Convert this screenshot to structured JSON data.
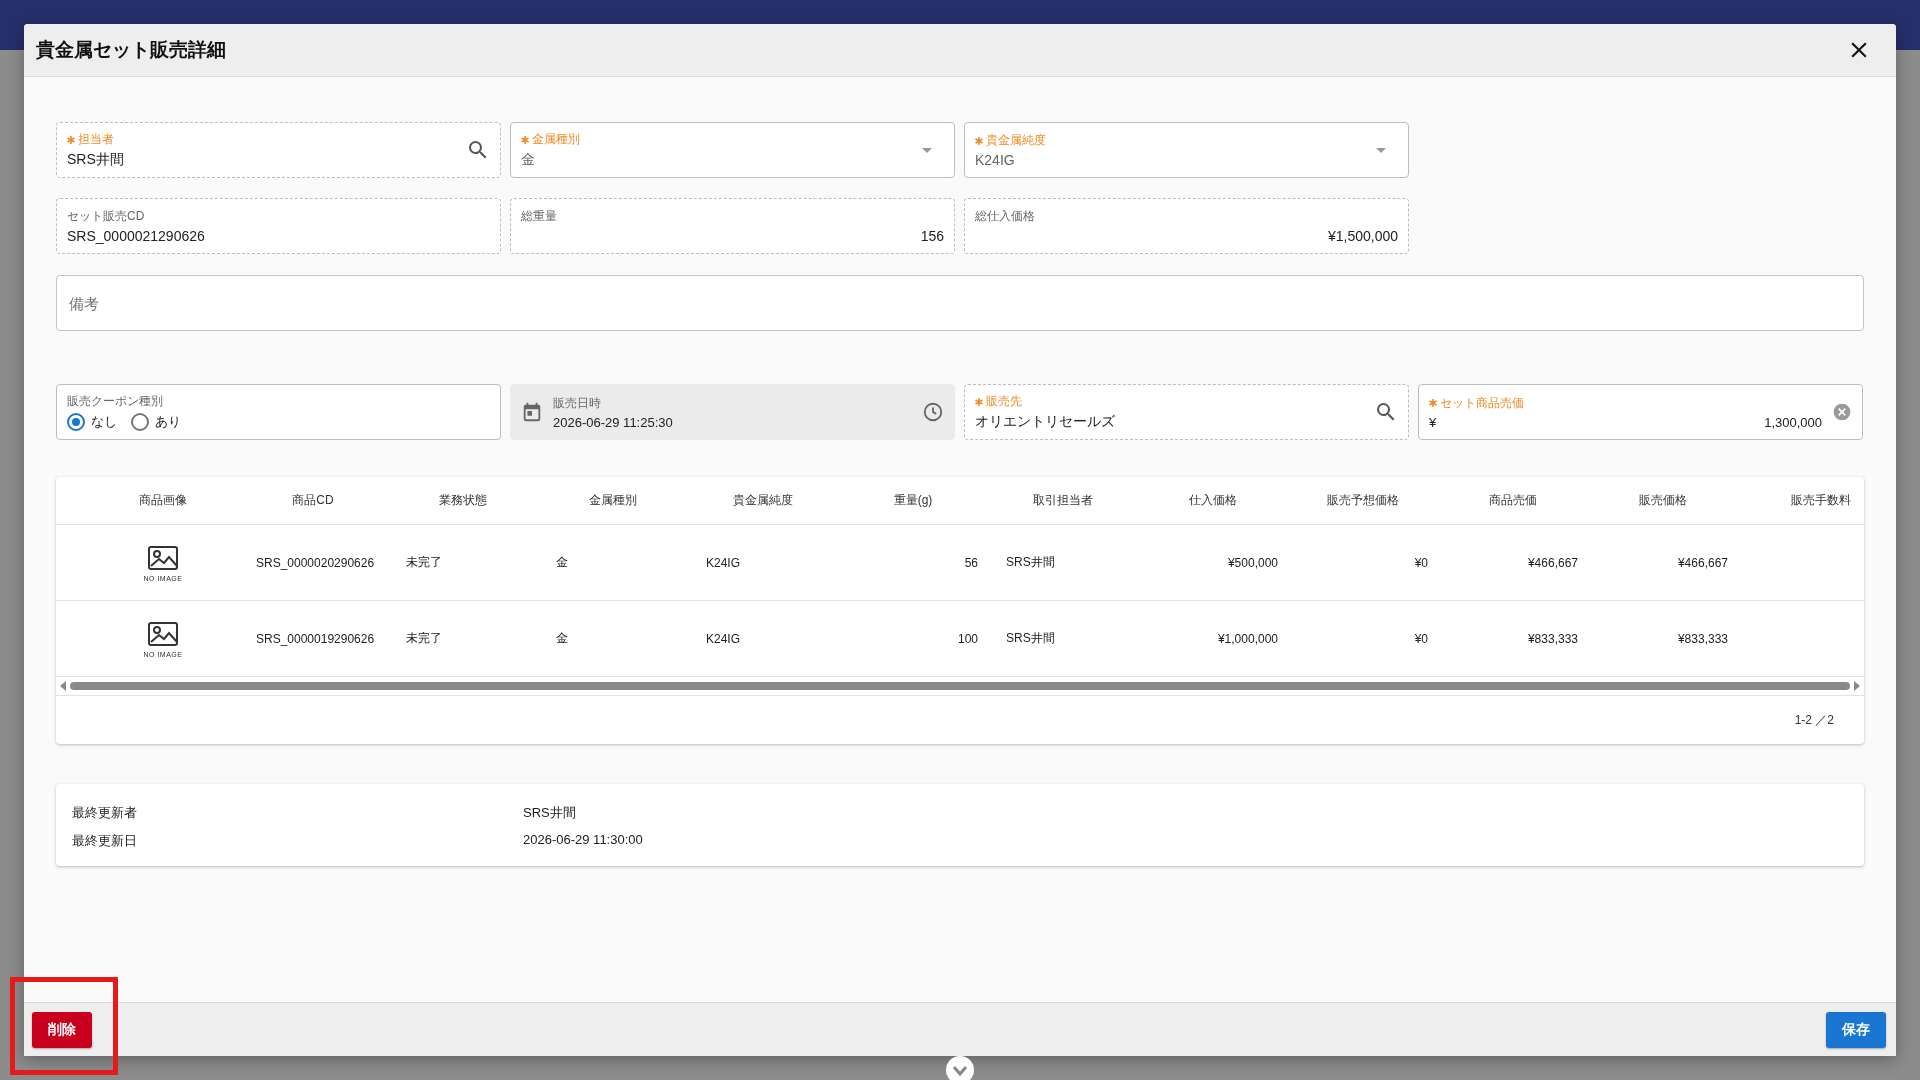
{
  "dialog": {
    "title": "貴金属セット販売詳細"
  },
  "fields": [
    {
      "kind": "search",
      "label": "担当者",
      "required": true,
      "value": "SRS井間"
    },
    {
      "kind": "select",
      "label": "金属種別",
      "required": true,
      "value": "金"
    },
    {
      "kind": "select",
      "label": "貴金属純度",
      "required": true,
      "value": "K24IG"
    },
    {
      "kind": "readonly_text",
      "label": "セット販売CD",
      "required": false,
      "value": "SRS_0000021290626"
    },
    {
      "kind": "readonly_number",
      "label": "総重量",
      "required": false,
      "value": "156"
    },
    {
      "kind": "readonly_number",
      "label": "総仕入価格",
      "required": false,
      "value": "¥1,500,000"
    }
  ],
  "remarks": {
    "placeholder": "備考"
  },
  "sale_fields": [
    {
      "kind": "radio",
      "label": "販売クーポン種別",
      "required": false,
      "options": [
        {
          "label": "なし",
          "selected": true
        },
        {
          "label": "あり",
          "selected": false
        }
      ]
    },
    {
      "kind": "datetime",
      "label": "販売日時",
      "required": false,
      "value": "2026-06-29 11:25:30"
    },
    {
      "kind": "search",
      "label": "販売先",
      "required": true,
      "value": "オリエントリセールズ"
    },
    {
      "kind": "money",
      "label": "セット商品売価",
      "required": true,
      "prefix": "¥",
      "value": "1,300,000"
    }
  ],
  "table": {
    "columns": [
      {
        "label": "商品画像",
        "kind": "image"
      },
      {
        "label": "商品CD",
        "kind": "text"
      },
      {
        "label": "業務状態",
        "kind": "text"
      },
      {
        "label": "金属種別",
        "kind": "text"
      },
      {
        "label": "貴金属純度",
        "kind": "text"
      },
      {
        "label": "重量(g)",
        "kind": "number"
      },
      {
        "label": "取引担当者",
        "kind": "text"
      },
      {
        "label": "仕入価格",
        "kind": "number"
      },
      {
        "label": "販売予想価格",
        "kind": "number"
      },
      {
        "label": "商品売価",
        "kind": "number"
      },
      {
        "label": "販売価格",
        "kind": "number"
      },
      {
        "label": "販売手数料",
        "kind": "number"
      }
    ],
    "rows": [
      {
        "cells": [
          "NO IMAGE",
          "SRS_0000020290626",
          "未完了",
          "金",
          "K24IG",
          "56",
          "SRS井間",
          "¥500,000",
          "¥0",
          "¥466,667",
          "¥466,667"
        ]
      },
      {
        "cells": [
          "NO IMAGE",
          "SRS_0000019290626",
          "未完了",
          "金",
          "K24IG",
          "100",
          "SRS井間",
          "¥1,000,000",
          "¥0",
          "¥833,333",
          "¥833,333"
        ]
      }
    ],
    "pagination": "1-2 ／2"
  },
  "info": [
    {
      "label": "最終更新者",
      "value": "SRS井間"
    },
    {
      "label": "最終更新日",
      "value": "2026-06-29 11:30:00"
    }
  ],
  "footer": {
    "delete_button": {
      "label": "削除",
      "highlighted": true
    },
    "save_button": {
      "label": "保存"
    }
  }
}
